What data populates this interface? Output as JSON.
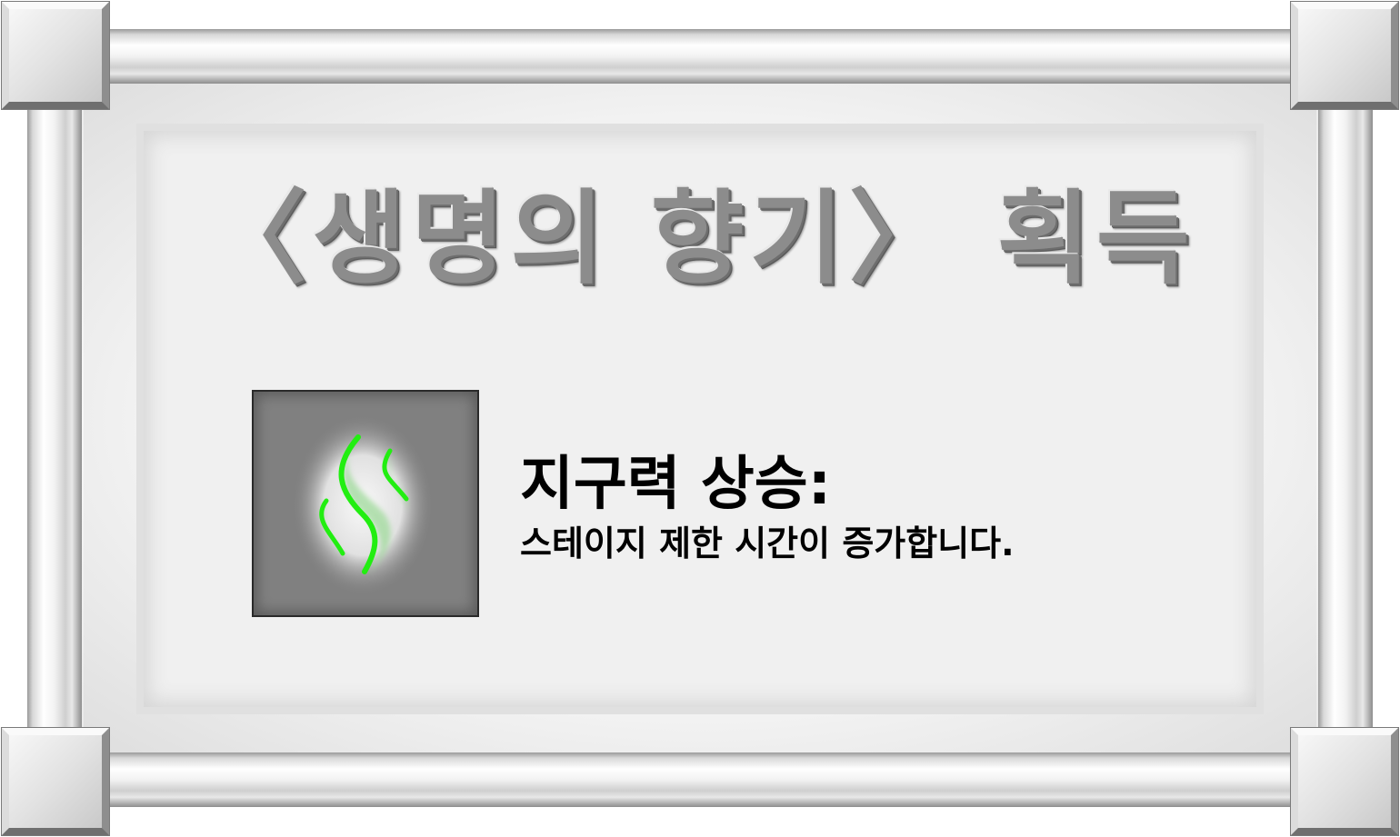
{
  "popup": {
    "title": "〈생명의 향기〉 획득",
    "item": {
      "icon": "green-scent-wisps-icon",
      "icon_color": "#22ee11",
      "icon_bg_color": "#808080"
    },
    "effect_title": "지구력 상승:",
    "effect_description": "스테이지 제한 시간이 증가합니다."
  }
}
